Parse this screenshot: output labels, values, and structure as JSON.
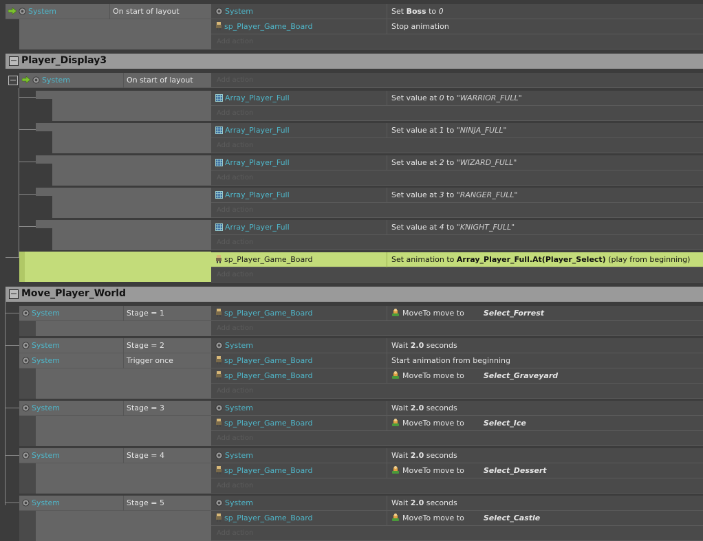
{
  "add_action_label": "Add action",
  "top": {
    "cond_object": "System",
    "cond_text": "On start of layout",
    "actions": [
      {
        "obj": "System",
        "icon": "gear-icon",
        "pre": "Set ",
        "bold": "Boss",
        "mid": " to ",
        "ital": "0"
      },
      {
        "obj": "sp_Player_Game_Board",
        "icon": "sprite-icon",
        "text": "Stop animation"
      }
    ]
  },
  "group1": {
    "title": "Player_Display3",
    "cond_object": "System",
    "cond_text": "On start of layout",
    "subactions": [
      {
        "obj": "Array_Player_Full",
        "pre": "Set value at ",
        "idx": "0",
        "mid": " to ",
        "str": "\"WARRIOR_FULL\""
      },
      {
        "obj": "Array_Player_Full",
        "pre": "Set value at ",
        "idx": "1",
        "mid": " to ",
        "str": "\"NINJA_FULL\""
      },
      {
        "obj": "Array_Player_Full",
        "pre": "Set value at ",
        "idx": "2",
        "mid": " to ",
        "str": "\"WIZARD_FULL\""
      },
      {
        "obj": "Array_Player_Full",
        "pre": "Set value at ",
        "idx": "3",
        "mid": " to ",
        "str": "\"RANGER_FULL\""
      },
      {
        "obj": "Array_Player_Full",
        "pre": "Set value at ",
        "idx": "4",
        "mid": " to ",
        "str": "\"KNIGHT_FULL\""
      }
    ],
    "selected": {
      "obj": "sp_Player_Game_Board",
      "pre": "Set animation to ",
      "bold": "Array_Player_Full.At(Player_Select)",
      "post": " (play from beginning)"
    }
  },
  "group2": {
    "title": "Move_Player_World",
    "events": [
      {
        "conds": [
          {
            "obj": "System",
            "text": "Stage = 1"
          }
        ],
        "actions": [
          {
            "obj": "sp_Player_Game_Board",
            "type": "move",
            "text": "MoveTo move to",
            "target": "Select_Forrest"
          }
        ]
      },
      {
        "conds": [
          {
            "obj": "System",
            "text": "Stage = 2"
          },
          {
            "obj": "System",
            "text": "Trigger once"
          }
        ],
        "actions": [
          {
            "obj": "System",
            "type": "wait",
            "pre": "Wait ",
            "bold": "2.0",
            "post": " seconds"
          },
          {
            "obj": "sp_Player_Game_Board",
            "type": "plain",
            "text": "Start animation from beginning"
          },
          {
            "obj": "sp_Player_Game_Board",
            "type": "move",
            "text": "MoveTo move to",
            "target": "Select_Graveyard"
          }
        ]
      },
      {
        "conds": [
          {
            "obj": "System",
            "text": "Stage = 3"
          }
        ],
        "actions": [
          {
            "obj": "System",
            "type": "wait",
            "pre": "Wait ",
            "bold": "2.0",
            "post": " seconds"
          },
          {
            "obj": "sp_Player_Game_Board",
            "type": "move",
            "text": "MoveTo move to",
            "target": "Select_Ice"
          }
        ]
      },
      {
        "conds": [
          {
            "obj": "System",
            "text": "Stage = 4"
          }
        ],
        "actions": [
          {
            "obj": "System",
            "type": "wait",
            "pre": "Wait ",
            "bold": "2.0",
            "post": " seconds"
          },
          {
            "obj": "sp_Player_Game_Board",
            "type": "move",
            "text": "MoveTo move to",
            "target": "Select_Dessert"
          }
        ]
      },
      {
        "conds": [
          {
            "obj": "System",
            "text": "Stage = 5"
          }
        ],
        "actions": [
          {
            "obj": "System",
            "type": "wait",
            "pre": "Wait ",
            "bold": "2.0",
            "post": " seconds"
          },
          {
            "obj": "sp_Player_Game_Board",
            "type": "move",
            "text": "MoveTo move to",
            "target": "Select_Castle"
          }
        ]
      }
    ]
  },
  "colors": {
    "selected": "#c3dc7a",
    "object_name": "#4fb6c9",
    "group_header": "#9a9a9a"
  }
}
